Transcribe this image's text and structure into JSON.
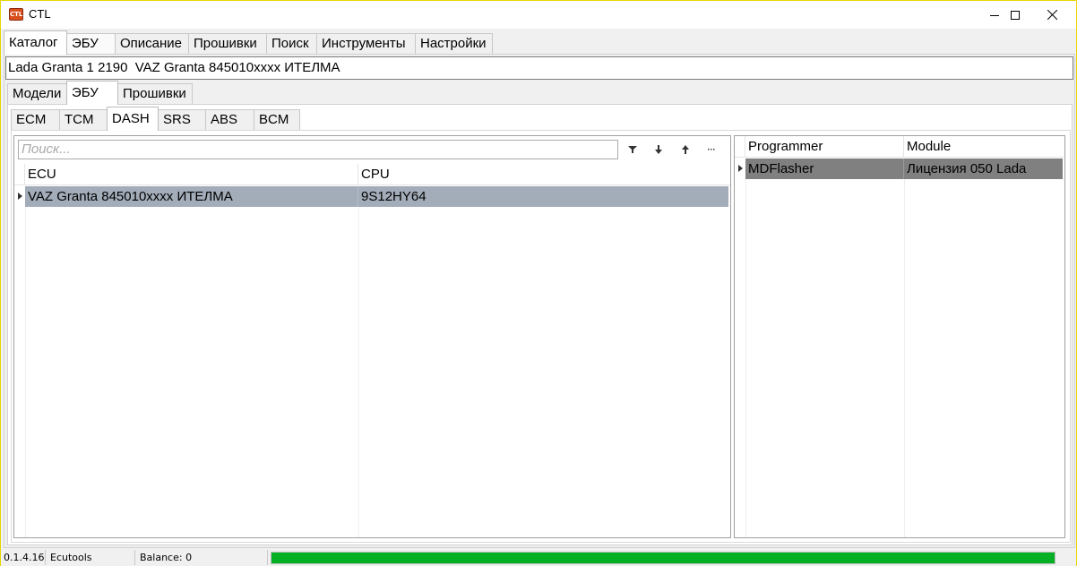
{
  "window": {
    "title": "CTL",
    "icon": "ctl-app-icon",
    "icon_text": "CTL",
    "controls": [
      "minimize-icon",
      "maximize-icon",
      "close-icon"
    ]
  },
  "main_tabs": [
    {
      "label": "Каталог",
      "active": true
    },
    {
      "label": "ЭБУ",
      "active": false
    },
    {
      "label": "Описание",
      "active": false
    },
    {
      "label": "Прошивки",
      "active": false
    },
    {
      "label": "Поиск",
      "active": false
    },
    {
      "label": "Инструменты",
      "active": false
    },
    {
      "label": "Настройки",
      "active": false
    }
  ],
  "selector_text": "Lada Granta 1 2190  VAZ Granta 845010xxxx ИТЕЛМА",
  "sub_tabs": [
    {
      "label": "Модели",
      "active": false
    },
    {
      "label": "ЭБУ",
      "active": true
    },
    {
      "label": "Прошивки",
      "active": false
    }
  ],
  "ecu_tabs": [
    {
      "label": "ECM",
      "active": false
    },
    {
      "label": "TCM",
      "active": false
    },
    {
      "label": "DASH",
      "active": true
    },
    {
      "label": "SRS",
      "active": false
    },
    {
      "label": "ABS",
      "active": false
    },
    {
      "label": "BCM",
      "active": false
    }
  ],
  "left_grid": {
    "search_placeholder": "Поиск...",
    "toolbar": [
      "filter-icon",
      "sort-down-icon",
      "sort-up-icon",
      "more-icon"
    ],
    "more_label": "···",
    "columns": [
      "ECU",
      "CPU"
    ],
    "rows": [
      {
        "ecu": "VAZ Granta 845010xxxx ИТЕЛМА",
        "cpu": "9S12HY64",
        "selected": true
      }
    ]
  },
  "right_grid": {
    "columns": [
      "Programmer",
      "Module"
    ],
    "rows": [
      {
        "programmer": "MDFlasher",
        "module": "Лицензия 050 Lada",
        "selected": true
      }
    ]
  },
  "status": {
    "version": "0.1.4.16",
    "brand": "Ecutools",
    "balance": "Balance: 0",
    "progress_fraction": 1.0,
    "progress_color": "#06b025"
  },
  "colors": {
    "selected_row_left": "#a3acb9",
    "selected_row_right": "#808080",
    "window_border": "#e6d600"
  }
}
